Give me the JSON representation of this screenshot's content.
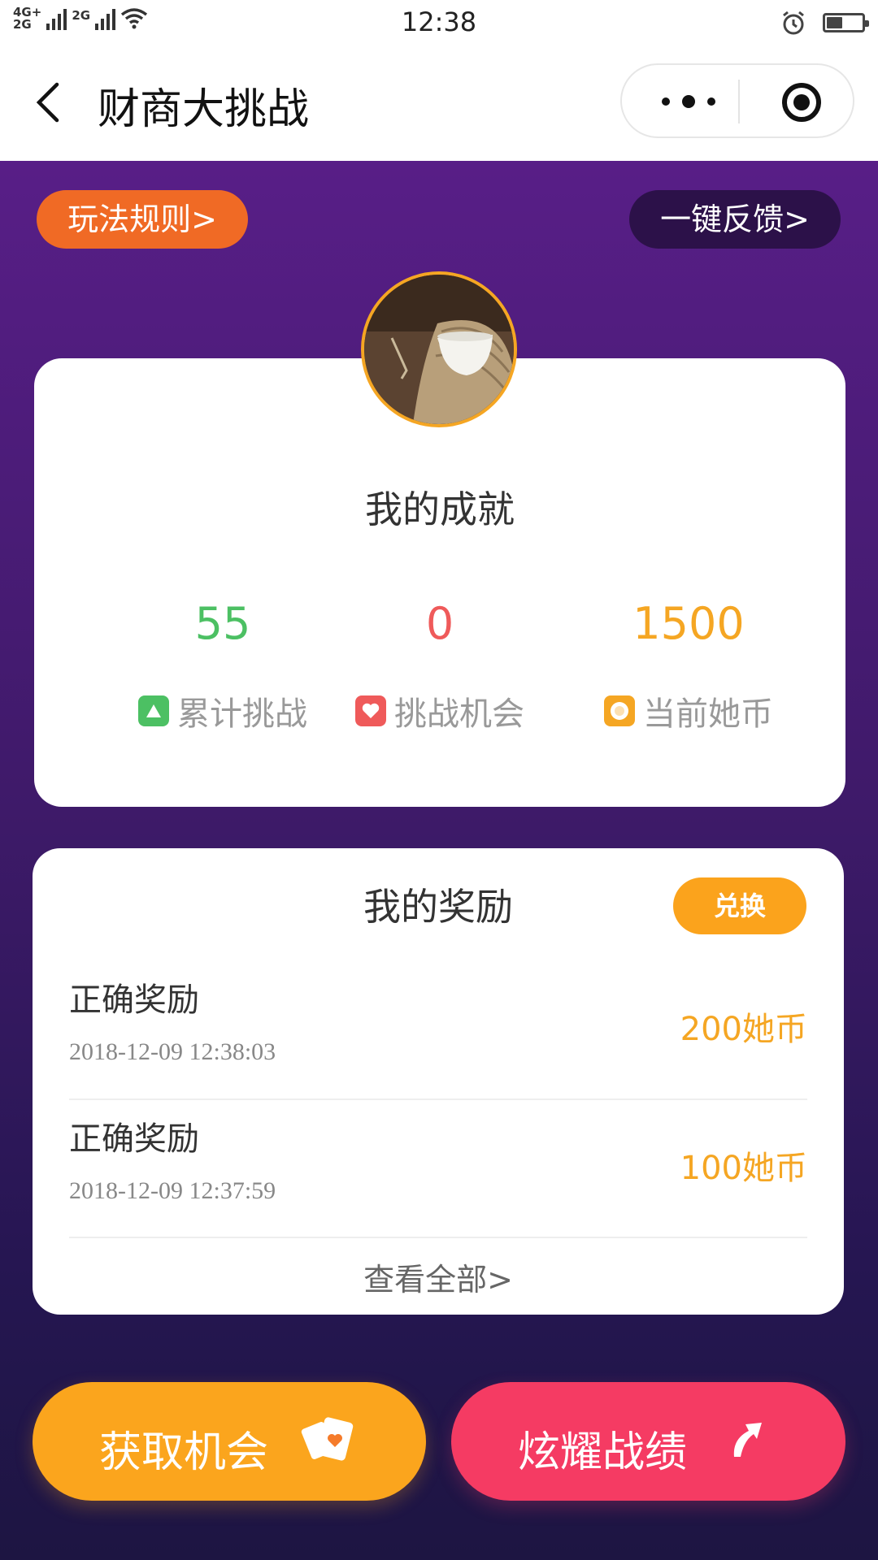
{
  "status_bar": {
    "network_top": "4G+",
    "network_bottom": "2G",
    "network_2g": "2G",
    "time": "12:38",
    "battery_level": 0.45
  },
  "nav": {
    "title": "财商大挑战"
  },
  "actions": {
    "rules": "玩法规则>",
    "feedback": "一键反馈>"
  },
  "achievements": {
    "title": "我的成就",
    "stats": [
      {
        "value": "55",
        "label": "累计挑战",
        "color": "#4cc063",
        "icon": "triangle-icon"
      },
      {
        "value": "0",
        "label": "挑战机会",
        "color": "#ef5a5a",
        "icon": "heart-icon"
      },
      {
        "value": "1500",
        "label": "当前她币",
        "color": "#f5a623",
        "icon": "coin-icon"
      }
    ]
  },
  "rewards": {
    "title": "我的奖励",
    "exchange_label": "兑换",
    "items": [
      {
        "name": "正确奖励",
        "time": "2018-12-09 12:38:03",
        "amount": "200她币"
      },
      {
        "name": "正确奖励",
        "time": "2018-12-09 12:37:59",
        "amount": "100她币"
      }
    ],
    "view_all": "查看全部>"
  },
  "buttons": {
    "get_chance": "获取机会",
    "show_off": "炫耀战绩"
  }
}
